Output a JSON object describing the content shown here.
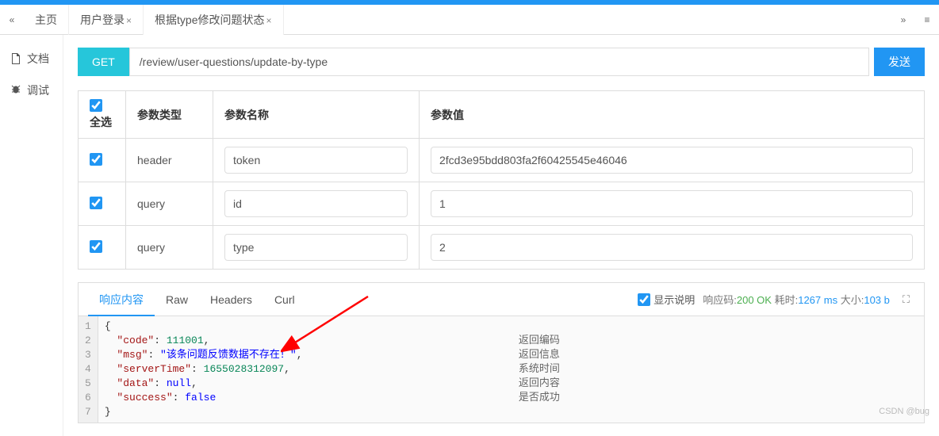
{
  "tabs": {
    "nav_left": "«",
    "nav_right": "»",
    "menu": "≡",
    "items": [
      {
        "label": "主页",
        "closable": false
      },
      {
        "label": "用户登录",
        "closable": true
      },
      {
        "label": "根据type修改问题状态",
        "closable": true,
        "active": true
      }
    ]
  },
  "sidebar": {
    "items": [
      {
        "icon": "document-icon",
        "label": "文档"
      },
      {
        "icon": "debug-icon",
        "label": "调试"
      }
    ]
  },
  "request": {
    "method": "GET",
    "url": "/review/user-questions/update-by-type",
    "send_label": "发送"
  },
  "params": {
    "select_all_label": "全选",
    "headers": [
      "参数类型",
      "参数名称",
      "参数值"
    ],
    "rows": [
      {
        "checked": true,
        "type": "header",
        "name": "token",
        "value": "2fcd3e95bdd803fa2f60425545e46046"
      },
      {
        "checked": true,
        "type": "query",
        "name": "id",
        "value": "1"
      },
      {
        "checked": true,
        "type": "query",
        "name": "type",
        "value": "2"
      }
    ]
  },
  "response": {
    "tabs": [
      "响应内容",
      "Raw",
      "Headers",
      "Curl"
    ],
    "active_tab": 0,
    "show_desc_label": "显示说明",
    "status": {
      "code_label": "响应码:",
      "code": "200 OK",
      "time_label": "耗时:",
      "time": "1267 ms",
      "size_label": "大小:",
      "size": "103 b"
    },
    "body": {
      "code": 111001,
      "msg": "该条问题反馈数据不存在！",
      "serverTime": 1655028312097,
      "data": null,
      "success": false
    },
    "descriptions": [
      "",
      "返回编码",
      "返回信息",
      "系统时间",
      "返回内容",
      "是否成功",
      ""
    ]
  },
  "watermark": "CSDN @bug"
}
